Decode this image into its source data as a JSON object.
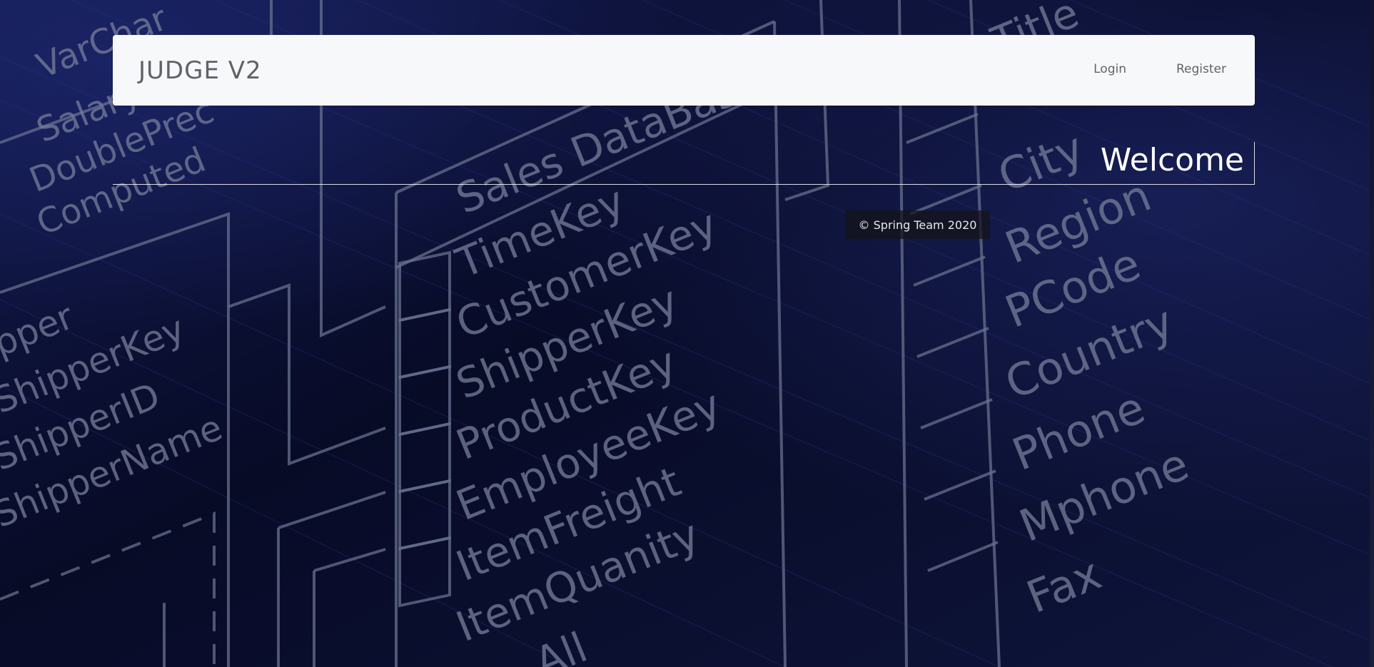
{
  "navbar": {
    "brand": "JUDGE V2",
    "links": [
      {
        "label": "Login"
      },
      {
        "label": "Register"
      }
    ]
  },
  "main": {
    "heading": "Welcome"
  },
  "footer": {
    "copyright": "© Spring Team 2020"
  },
  "background": {
    "theme": "database-schema-illustration",
    "colors": {
      "base": "#0a0f2c",
      "lines": "#8a96b8",
      "streaks": "#2c3aa0"
    }
  }
}
